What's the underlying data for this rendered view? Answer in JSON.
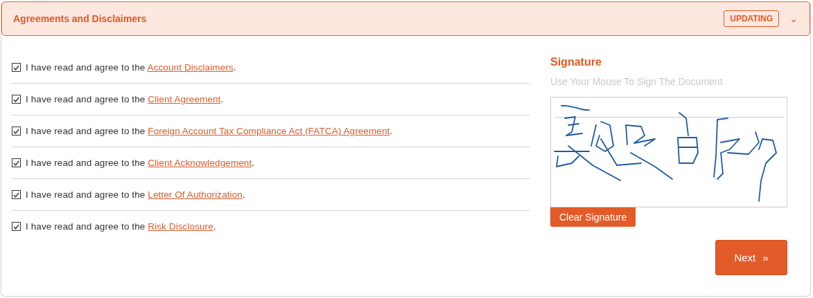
{
  "panel": {
    "title": "Agreements and Disclaimers",
    "status_badge": "UPDATING",
    "chevron": "⌄",
    "expanded": true
  },
  "agreements": [
    {
      "prefix": "I have read and agree to the ",
      "link": "Account Disclaimers",
      "suffix": ".",
      "checked": true
    },
    {
      "prefix": "I have read and agree to the ",
      "link": "Client Agreement",
      "suffix": ".",
      "checked": true
    },
    {
      "prefix": "I have read and agree to the ",
      "link": "Foreign Account Tax Compliance Act (FATCA) Agreement",
      "suffix": ".",
      "checked": true
    },
    {
      "prefix": "I have read and agree to the ",
      "link": "Client Acknowledgement",
      "suffix": ".",
      "checked": true
    },
    {
      "prefix": "I have read and agree to the ",
      "link": "Letter Of Authorization",
      "suffix": ".",
      "checked": true
    },
    {
      "prefix": "I have read and agree to the ",
      "link": "Risk Disclosure",
      "suffix": ".",
      "checked": true
    }
  ],
  "signature": {
    "title": "Signature",
    "hint": "Use Your Mouse To Sign The Document",
    "signed": true,
    "clear_button": "Clear Signature"
  },
  "next_button": {
    "label": "Next",
    "icon": "»"
  }
}
